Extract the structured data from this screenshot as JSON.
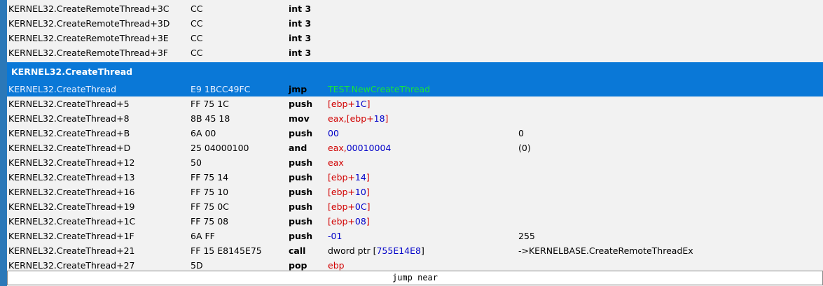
{
  "rows_before": [
    {
      "address": "KERNEL32.CreateRemoteThread+3C",
      "bytes": "CC",
      "mnemonic": "int 3"
    },
    {
      "address": "KERNEL32.CreateRemoteThread+3D",
      "bytes": "CC",
      "mnemonic": "int 3"
    },
    {
      "address": "KERNEL32.CreateRemoteThread+3E",
      "bytes": "CC",
      "mnemonic": "int 3"
    },
    {
      "address": "KERNEL32.CreateRemoteThread+3F",
      "bytes": "CC",
      "mnemonic": "int 3"
    }
  ],
  "function_label": "KERNEL32.CreateThread",
  "selected_row": {
    "address": "KERNEL32.CreateThread",
    "bytes": "E9 1BCC49FC",
    "mnemonic": "jmp",
    "operand": "TEST.NewCreateThread"
  },
  "rows_after": [
    {
      "address": "KERNEL32.CreateThread+5",
      "bytes": "FF 75 1C",
      "mnemonic": "push",
      "operand_parts": [
        {
          "t": "[ebp+",
          "c": "reg"
        },
        {
          "t": "1C",
          "c": "num"
        },
        {
          "t": "]",
          "c": "reg"
        }
      ],
      "comment": ""
    },
    {
      "address": "KERNEL32.CreateThread+8",
      "bytes": "8B 45 18",
      "mnemonic": "mov",
      "operand_parts": [
        {
          "t": "eax,[ebp+",
          "c": "reg"
        },
        {
          "t": "18",
          "c": "num"
        },
        {
          "t": "]",
          "c": "reg"
        }
      ],
      "comment": ""
    },
    {
      "address": "KERNEL32.CreateThread+B",
      "bytes": "6A 00",
      "mnemonic": "push",
      "operand_parts": [
        {
          "t": "00",
          "c": "num"
        }
      ],
      "comment": "0"
    },
    {
      "address": "KERNEL32.CreateThread+D",
      "bytes": "25 04000100",
      "mnemonic": "and",
      "operand_parts": [
        {
          "t": "eax,",
          "c": "reg"
        },
        {
          "t": "00010004",
          "c": "num"
        }
      ],
      "comment": "(0)"
    },
    {
      "address": "KERNEL32.CreateThread+12",
      "bytes": "50",
      "mnemonic": "push",
      "operand_parts": [
        {
          "t": "eax",
          "c": "reg"
        }
      ],
      "comment": ""
    },
    {
      "address": "KERNEL32.CreateThread+13",
      "bytes": "FF 75 14",
      "mnemonic": "push",
      "operand_parts": [
        {
          "t": "[ebp+",
          "c": "reg"
        },
        {
          "t": "14",
          "c": "num"
        },
        {
          "t": "]",
          "c": "reg"
        }
      ],
      "comment": ""
    },
    {
      "address": "KERNEL32.CreateThread+16",
      "bytes": "FF 75 10",
      "mnemonic": "push",
      "operand_parts": [
        {
          "t": "[ebp+",
          "c": "reg"
        },
        {
          "t": "10",
          "c": "num"
        },
        {
          "t": "]",
          "c": "reg"
        }
      ],
      "comment": ""
    },
    {
      "address": "KERNEL32.CreateThread+19",
      "bytes": "FF 75 0C",
      "mnemonic": "push",
      "operand_parts": [
        {
          "t": "[ebp+",
          "c": "reg"
        },
        {
          "t": "0C",
          "c": "num"
        },
        {
          "t": "]",
          "c": "reg"
        }
      ],
      "comment": ""
    },
    {
      "address": "KERNEL32.CreateThread+1C",
      "bytes": "FF 75 08",
      "mnemonic": "push",
      "operand_parts": [
        {
          "t": "[ebp+",
          "c": "reg"
        },
        {
          "t": "08",
          "c": "num"
        },
        {
          "t": "]",
          "c": "reg"
        }
      ],
      "comment": ""
    },
    {
      "address": "KERNEL32.CreateThread+1F",
      "bytes": "6A FF",
      "mnemonic": "push",
      "operand_parts": [
        {
          "t": "-01",
          "c": "num"
        }
      ],
      "comment": "255"
    },
    {
      "address": "KERNEL32.CreateThread+21",
      "bytes": "FF 15 E8145E75",
      "mnemonic": "call",
      "operand_parts": [
        {
          "t": "dword ptr [",
          "c": "plain"
        },
        {
          "t": "755E14E8",
          "c": "num"
        },
        {
          "t": "]",
          "c": "plain"
        }
      ],
      "comment": "->KERNELBASE.CreateRemoteThreadEx"
    },
    {
      "address": "KERNEL32.CreateThread+27",
      "bytes": "5D",
      "mnemonic": "pop",
      "operand_parts": [
        {
          "t": "ebp",
          "c": "reg"
        }
      ],
      "comment": ""
    }
  ],
  "status_text": "jump near",
  "colors": {
    "selection": "#0a78d7",
    "register": "#d10000",
    "number": "#0000c8",
    "symbol_highlight": "#17e53a"
  }
}
